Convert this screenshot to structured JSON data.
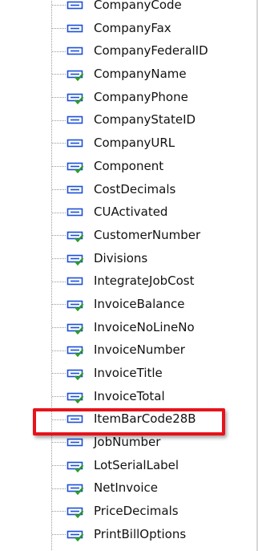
{
  "tree": {
    "items": [
      {
        "label": "CompanyCode",
        "icon": "field-icon"
      },
      {
        "label": "CompanyFax",
        "icon": "field-icon"
      },
      {
        "label": "CompanyFederalID",
        "icon": "field-icon"
      },
      {
        "label": "CompanyName",
        "icon": "field-check-icon"
      },
      {
        "label": "CompanyPhone",
        "icon": "field-check-icon"
      },
      {
        "label": "CompanyStateID",
        "icon": "field-icon"
      },
      {
        "label": "CompanyURL",
        "icon": "field-icon"
      },
      {
        "label": "Component",
        "icon": "field-check-icon"
      },
      {
        "label": "CostDecimals",
        "icon": "field-icon"
      },
      {
        "label": "CUActivated",
        "icon": "field-icon"
      },
      {
        "label": "CustomerNumber",
        "icon": "field-check-icon"
      },
      {
        "label": "Divisions",
        "icon": "field-check-icon"
      },
      {
        "label": "IntegrateJobCost",
        "icon": "field-icon"
      },
      {
        "label": "InvoiceBalance",
        "icon": "field-check-icon"
      },
      {
        "label": "InvoiceNoLineNo",
        "icon": "field-check-icon"
      },
      {
        "label": "InvoiceNumber",
        "icon": "field-check-icon"
      },
      {
        "label": "InvoiceTitle",
        "icon": "field-check-icon"
      },
      {
        "label": "InvoiceTotal",
        "icon": "field-check-icon"
      },
      {
        "label": "ItemBarCode28B",
        "icon": "field-icon",
        "highlighted": true
      },
      {
        "label": "JobNumber",
        "icon": "field-icon"
      },
      {
        "label": "LotSerialLabel",
        "icon": "field-check-icon"
      },
      {
        "label": "NetInvoice",
        "icon": "field-check-icon"
      },
      {
        "label": "PriceDecimals",
        "icon": "field-check-icon"
      },
      {
        "label": "PrintBillOptions",
        "icon": "field-check-icon"
      }
    ]
  },
  "colors": {
    "highlight_border": "#e8121a",
    "icon_blue": "#1a4fd6",
    "check_green": "#2a9d1f"
  }
}
